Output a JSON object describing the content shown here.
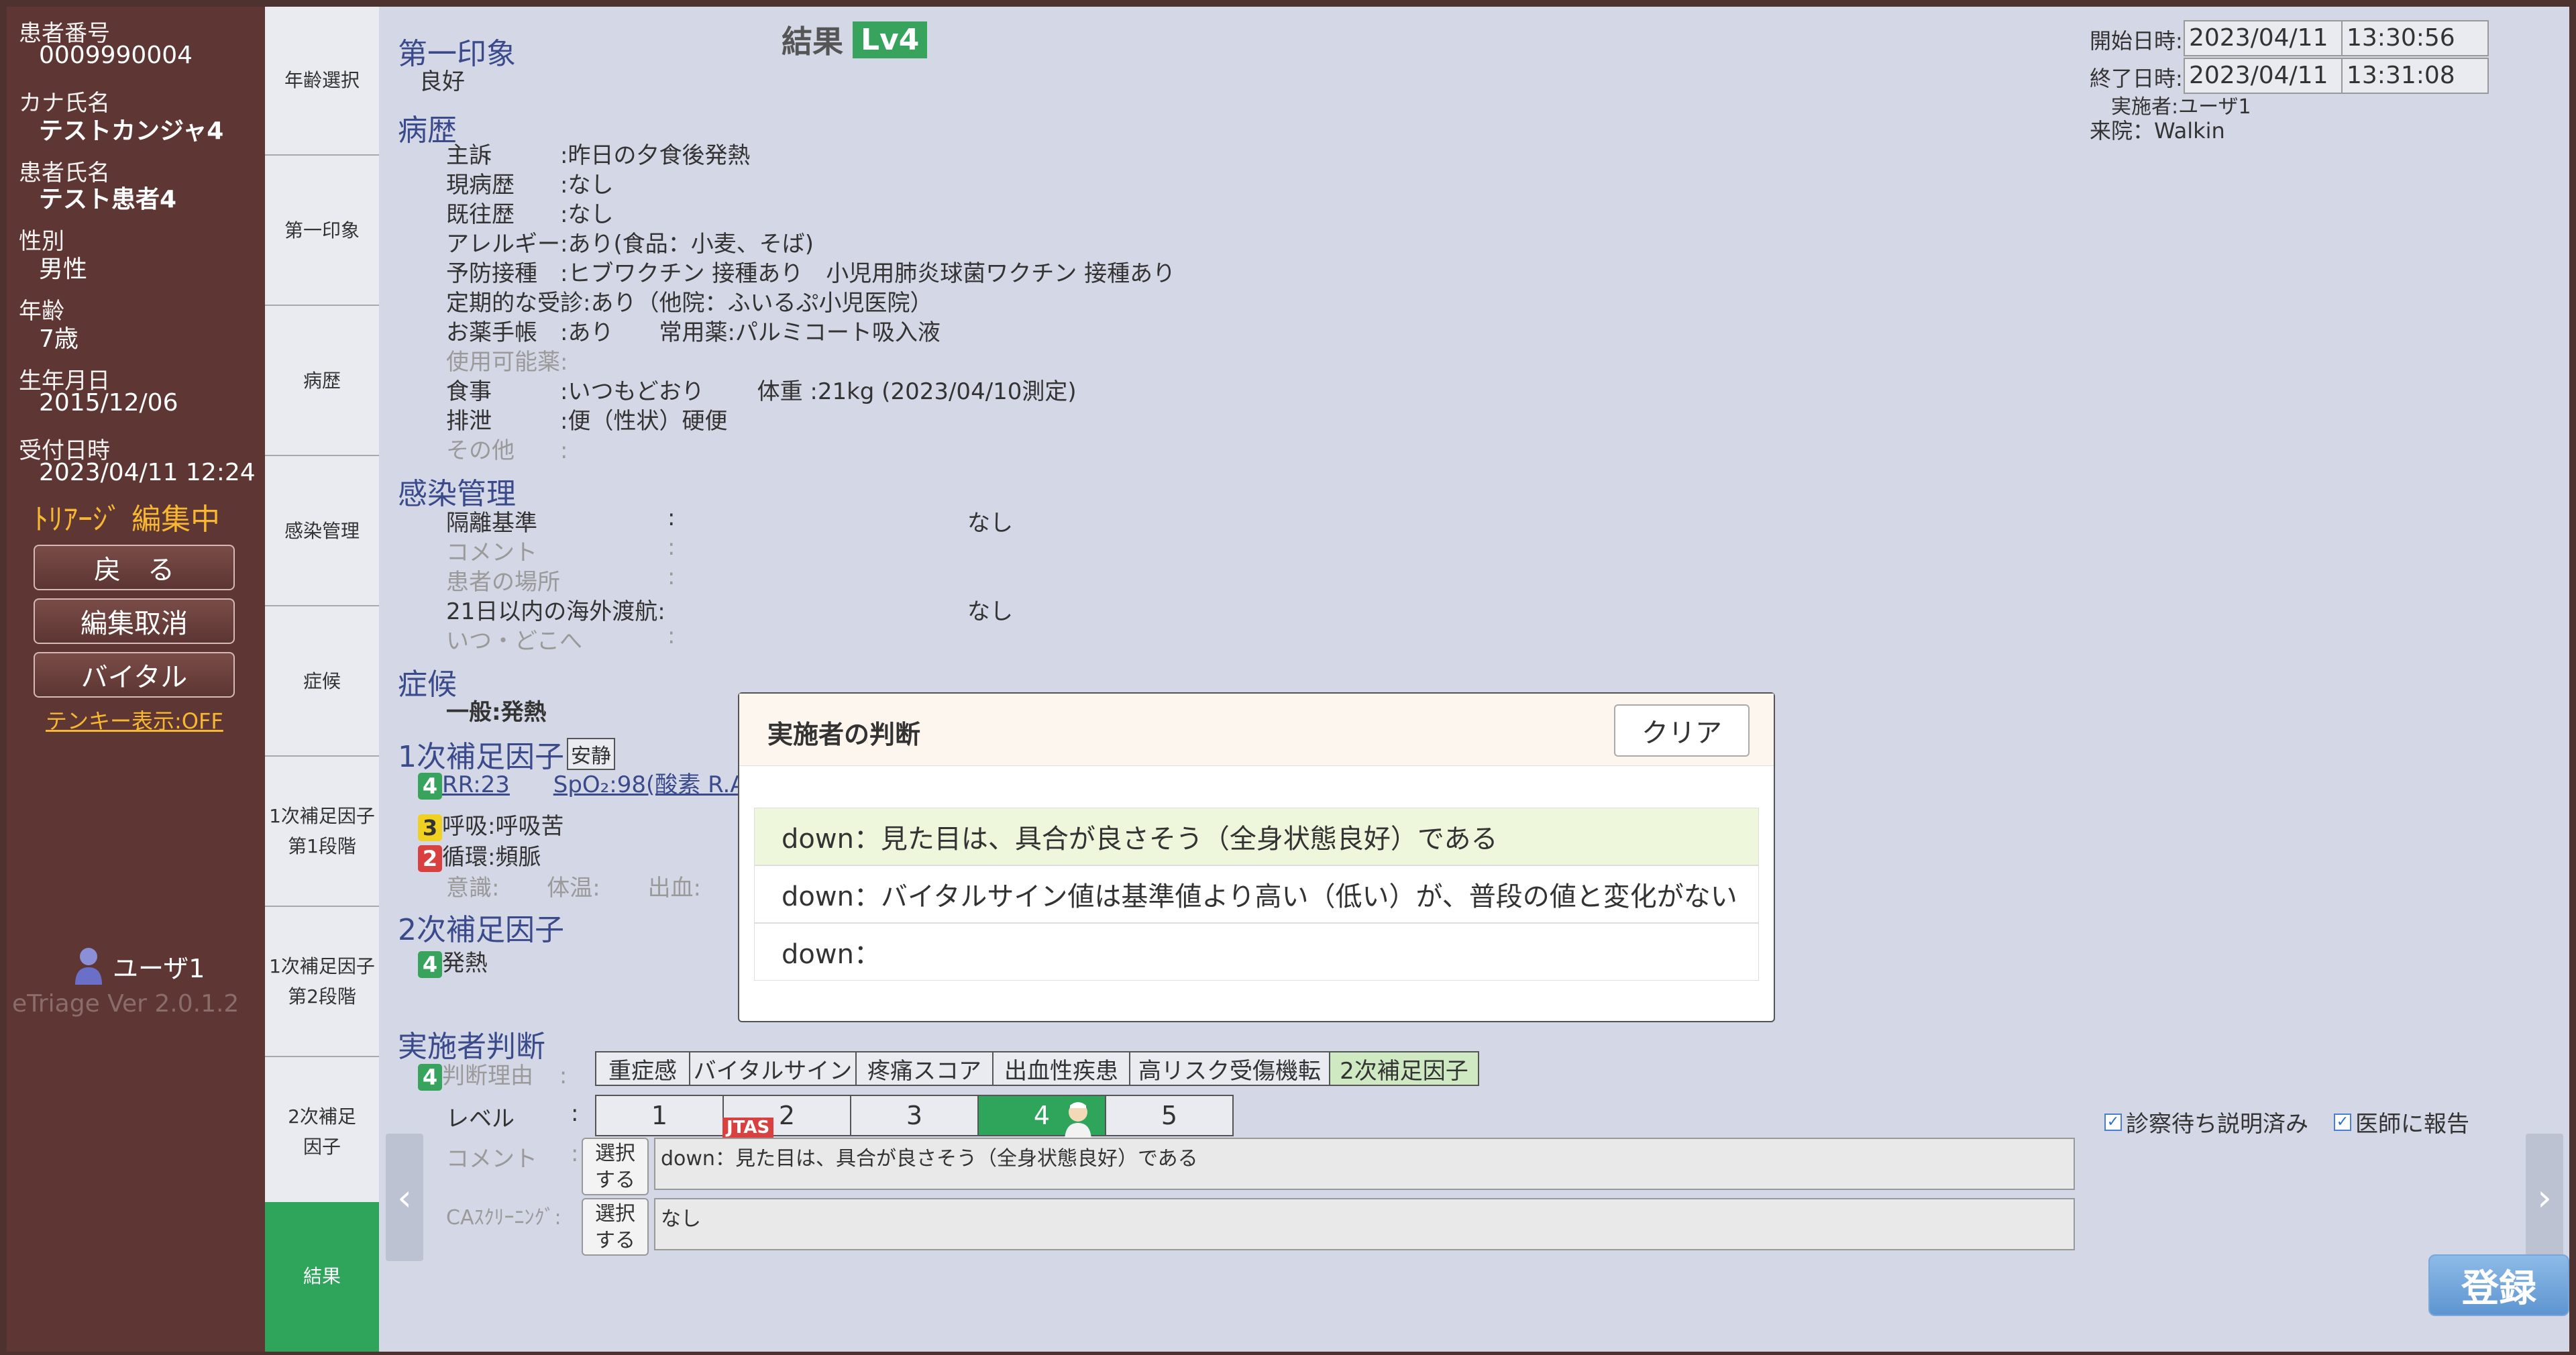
{
  "patient": {
    "id_label": "患者番号",
    "id": "0009990004",
    "kana_label": "カナ氏名",
    "kana": "テストカンジャ4",
    "name_label": "患者氏名",
    "name": "テスト患者4",
    "sex_label": "性別",
    "sex": "男性",
    "age_label": "年齢",
    "age": "7歳",
    "birth_label": "生年月日",
    "birth": "2015/12/06",
    "reception_label": "受付日時",
    "reception": "2023/04/11 12:24"
  },
  "sidebar": {
    "status": "ﾄﾘｱｰｼﾞ 編集中",
    "back": "戻　る",
    "cancel_edit": "編集取消",
    "vital": "バイタル",
    "tenkey": "テンキー表示:OFF",
    "user": "ユーザ1",
    "version": "eTriage Ver 2.0.1.2"
  },
  "nav": {
    "tabs": [
      "年齢選択",
      "第一印象",
      "病歴",
      "感染管理",
      "症候",
      "1次補足因子\n第1段階",
      "1次補足因子\n第2段階",
      "2次補足\n因子",
      "結果"
    ]
  },
  "header": {
    "result_label": "結果",
    "level": "Lv4",
    "start_label": "開始日時:",
    "start_date": "2023/04/11",
    "start_time": "13:30:56",
    "end_label": "終了日時:",
    "end_date": "2023/04/11",
    "end_time": "13:31:08",
    "operator": "実施者:ユーザ1",
    "arrival": "来院：Walkin"
  },
  "first_impression": {
    "title": "第一印象",
    "value": "良好"
  },
  "history": {
    "title": "病歴",
    "rows": [
      "主訴　　　:昨日の夕食後発熱",
      "現病歴　　:なし",
      "既往歴　　:なし",
      "アレルギー:あり(食品：小麦、そば)",
      "予防接種　:ヒブワクチン 接種あり　小児用肺炎球菌ワクチン 接種あり",
      "定期的な受診:あり（他院：ふいるぷ小児医院）",
      "お薬手帳　:あり　　常用薬:パルミコート吸入液",
      "使用可能薬:",
      "食事　　　:いつもどおり　　 体重 :21kg (2023/04/10測定)",
      "排泄　　　:便（性状）硬便",
      "その他　　:"
    ]
  },
  "infection": {
    "title": "感染管理",
    "rows": [
      {
        "label": "隔離基準",
        "colon": ":",
        "value": "なし"
      },
      {
        "label": "コメント",
        "colon": ":",
        "value": ""
      },
      {
        "label": "患者の場所",
        "colon": ":",
        "value": ""
      },
      {
        "label": "21日以内の海外渡航:",
        "colon": "",
        "value": "なし"
      },
      {
        "label": "いつ・どこへ",
        "colon": ":",
        "value": ""
      }
    ]
  },
  "symptom": {
    "title": "症候",
    "value": "一般:発熱"
  },
  "primary": {
    "title": "1次補足因子",
    "tag": "安静",
    "rr_badge": "4",
    "rr": "RR:23",
    "spo2": "SpO₂:98(酸素 R.A",
    "resp_badge": "3",
    "resp": "呼吸:呼吸苦",
    "circ_badge": "2",
    "circ": "循環:頻脈",
    "misc": [
      "意識:",
      "体温:",
      "出血:"
    ]
  },
  "secondary": {
    "title": "2次補足因子",
    "badge": "4",
    "value": "発熱"
  },
  "judgement": {
    "title": "実施者判断",
    "badge": "4",
    "reason_label": "判断理由",
    "reasons": [
      "重症感",
      "バイタルサイン",
      "疼痛スコア",
      "出血性疾患",
      "高リスク受傷機転",
      "2次補足因子"
    ],
    "level_label": "レベル",
    "levels": [
      "1",
      "2",
      "3",
      "4",
      "5"
    ],
    "jtas": "JTAS",
    "comment_label": "コメント",
    "select": "選択\nする",
    "comment": "down：見た目は、具合が良さそう（全身状態良好）である",
    "ca_label": "CAｽｸﾘｰﾆﾝｸﾞ:",
    "ca_value": "なし",
    "check1": "診察待ち説明済み",
    "check2": "医師に報告",
    "register": "登録"
  },
  "modal": {
    "title": "実施者の判断",
    "clear": "クリア",
    "options": [
      "down：見た目は、具合が良さそう（全身状態良好）である",
      "down：バイタルサイン値は基準値より高い（低い）が、普段の値と変化がない",
      "down："
    ]
  },
  "colors": {
    "sidebar": "#5e3634",
    "accent": "#2ea55b",
    "main_bg": "#d4d8e6",
    "section": "#3a4a8a"
  }
}
